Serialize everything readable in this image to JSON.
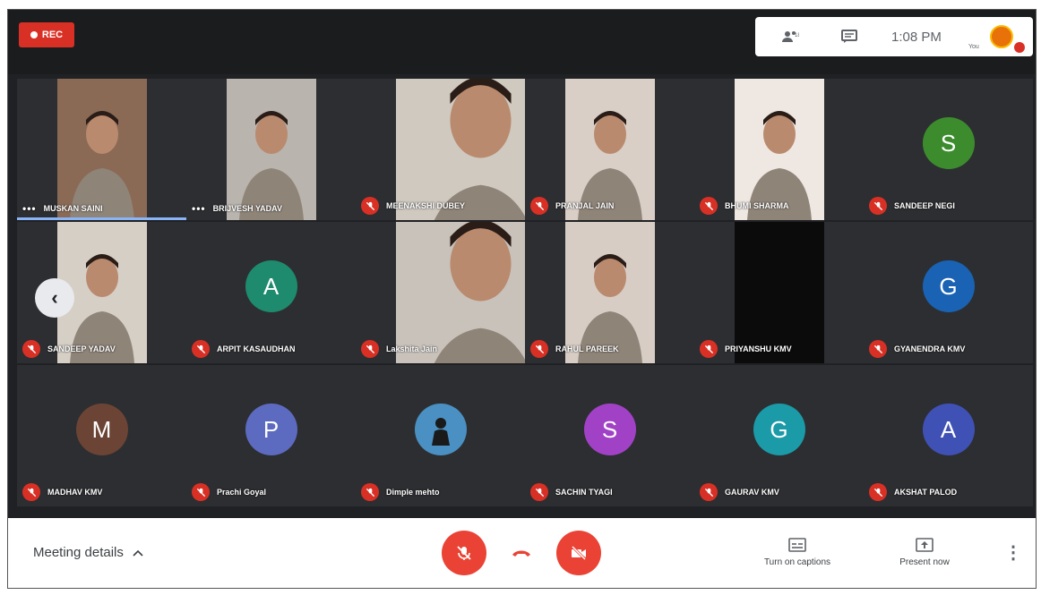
{
  "topbar": {
    "rec_label": "REC",
    "time": "1:08 PM",
    "you_label": "You",
    "icons": [
      "people-icon",
      "chat-icon"
    ]
  },
  "participants": [
    {
      "name": "MUSKAN SAINI",
      "kind": "video",
      "bg": "#8a6a55",
      "muted": false,
      "speaking": true
    },
    {
      "name": "BRIJVESH YADAV",
      "kind": "video",
      "bg": "#b9b4ad",
      "muted": false,
      "more": true
    },
    {
      "name": "MEENAKSHI DUBEY",
      "kind": "video",
      "bg": "#cfc9c0",
      "muted": true
    },
    {
      "name": "PRANJAL JAIN",
      "kind": "video",
      "bg": "#d9cfc7",
      "muted": true
    },
    {
      "name": "BHUMI SHARMA",
      "kind": "video",
      "bg": "#efe8e2",
      "muted": true
    },
    {
      "name": "SANDEEP NEGI",
      "kind": "avatar",
      "letter": "S",
      "color": "#3c8c2e",
      "muted": true
    },
    {
      "name": "SANDEEP YADAV",
      "kind": "video",
      "bg": "#d6cfc6",
      "muted": true
    },
    {
      "name": "ARPIT KASAUDHAN",
      "kind": "avatar",
      "letter": "A",
      "color": "#1e8a6e",
      "muted": true
    },
    {
      "name": "Lakshita Jain",
      "kind": "video",
      "bg": "#c8c2bb",
      "muted": true
    },
    {
      "name": "RAHUL PAREEK",
      "kind": "video",
      "bg": "#d8cdc4",
      "muted": true
    },
    {
      "name": "PRIYANSHU KMV",
      "kind": "video",
      "bg": "#0b0b0c",
      "muted": true
    },
    {
      "name": "GYANENDRA KMV",
      "kind": "avatar",
      "letter": "G",
      "color": "#1a62b3",
      "muted": true
    },
    {
      "name": "MADHAV KMV",
      "kind": "avatar",
      "letter": "M",
      "color": "#6b4435",
      "muted": true
    },
    {
      "name": "Prachi Goyal",
      "kind": "avatar",
      "letter": "P",
      "color": "#5c6bc0",
      "muted": true
    },
    {
      "name": "Dimple mehto",
      "kind": "photo",
      "color": "#4a90c2",
      "muted": true
    },
    {
      "name": "SACHIN TYAGI",
      "kind": "avatar",
      "letter": "S",
      "color": "#a142c6",
      "muted": true
    },
    {
      "name": "GAURAV KMV",
      "kind": "avatar",
      "letter": "G",
      "color": "#1b9aa8",
      "muted": true
    },
    {
      "name": "AKSHAT PALOD",
      "kind": "avatar",
      "letter": "A",
      "color": "#3f51b5",
      "muted": true
    }
  ],
  "bottombar": {
    "meeting_details": "Meeting details",
    "captions": "Turn on captions",
    "present": "Present now"
  },
  "colors": {
    "accent_red": "#ea4335",
    "tile_bg": "#2d2e31",
    "speaking": "#8ab4f8"
  }
}
